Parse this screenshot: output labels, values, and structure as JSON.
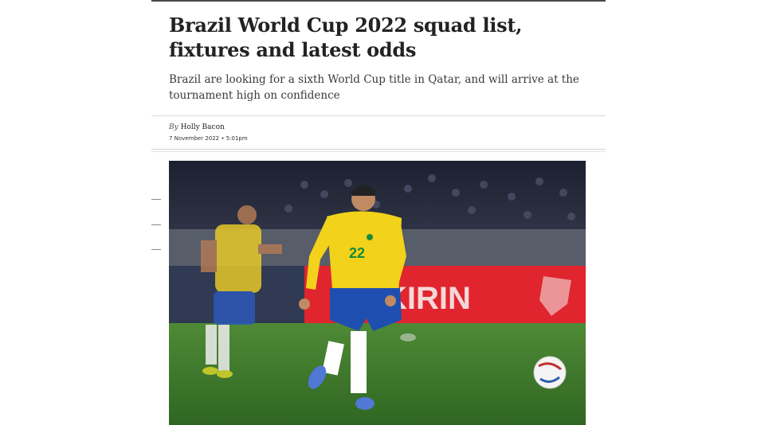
{
  "article": {
    "headline": "Brazil World Cup 2022 squad list, fixtures and latest odds",
    "standfirst": "Brazil are looking for a sixth World Cup title in Qatar, and will arrive at the tournament high on confidence",
    "byline_prefix": "By",
    "author": "Holly Bacon",
    "date": "7 November 2022 • 5:01pm"
  },
  "photo": {
    "player_number": "22",
    "sponsor_board": "KIRIN",
    "colors": {
      "shirt": "#f2d21b",
      "shorts": "#1e4fb0",
      "pitch": "#3f7a2c",
      "board": "#e0252f"
    }
  }
}
